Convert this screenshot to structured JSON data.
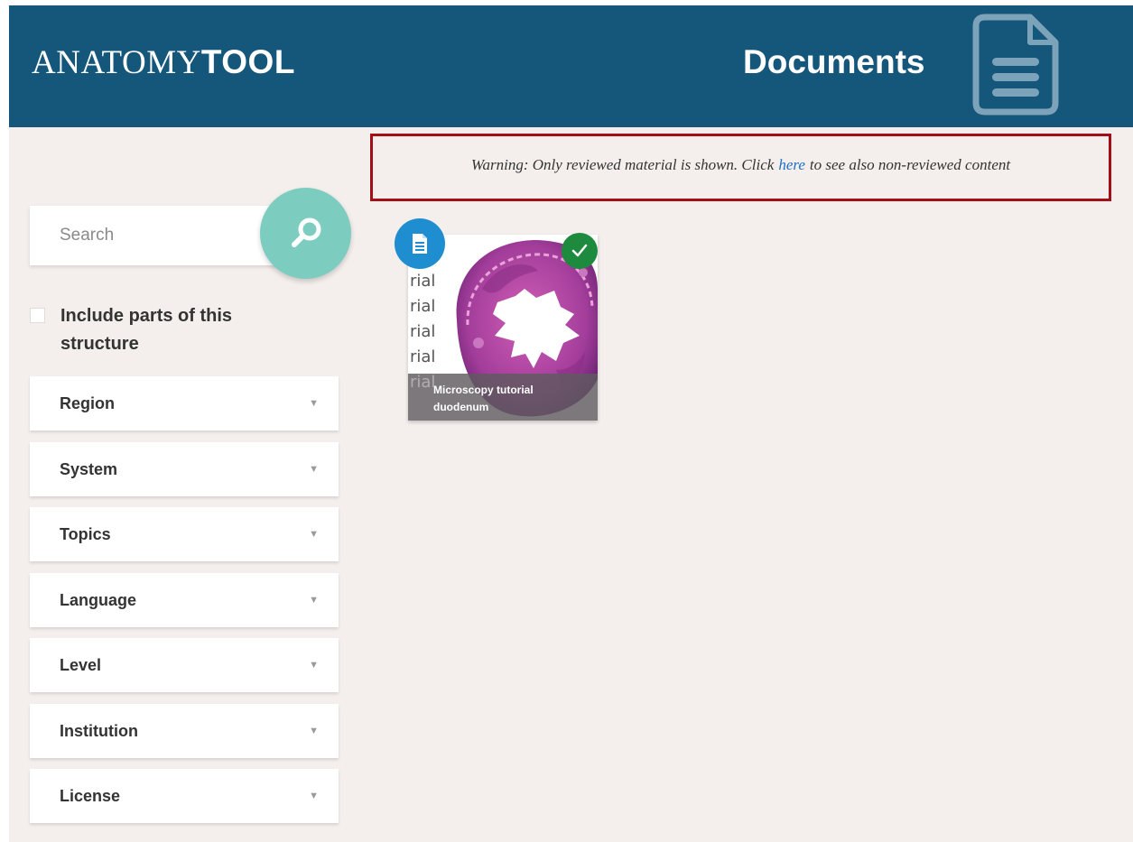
{
  "header": {
    "logo_light": "ANATOMY",
    "logo_bold": "TOOL",
    "page_title": "Documents"
  },
  "warning": {
    "before": "Warning: Only reviewed material is shown. Click",
    "link": "here",
    "after": "to see also non-reviewed content"
  },
  "search": {
    "placeholder": "Search"
  },
  "include_parts": {
    "label": "Include parts of this structure",
    "checked": false
  },
  "filters": [
    {
      "label": "Region"
    },
    {
      "label": "System"
    },
    {
      "label": "Topics"
    },
    {
      "label": "Language"
    },
    {
      "label": "Level"
    },
    {
      "label": "Institution"
    },
    {
      "label": "License"
    }
  ],
  "cards": [
    {
      "title_line1": "Microscopy tutorial",
      "title_line2": "duodenum",
      "ghost_text": [
        "rial",
        "rial",
        "rial",
        "rial"
      ],
      "ghost_tail": "rial",
      "type_icon": "document-icon",
      "reviewed": true
    }
  ],
  "colors": {
    "header_bg": "#15567b",
    "page_bg": "#f4efed",
    "search_button": "#7ccdc0",
    "warning_border": "#a30f18",
    "link": "#1f6fc2",
    "type_badge": "#1f8ed0",
    "reviewed_badge": "#1e8a3e"
  }
}
